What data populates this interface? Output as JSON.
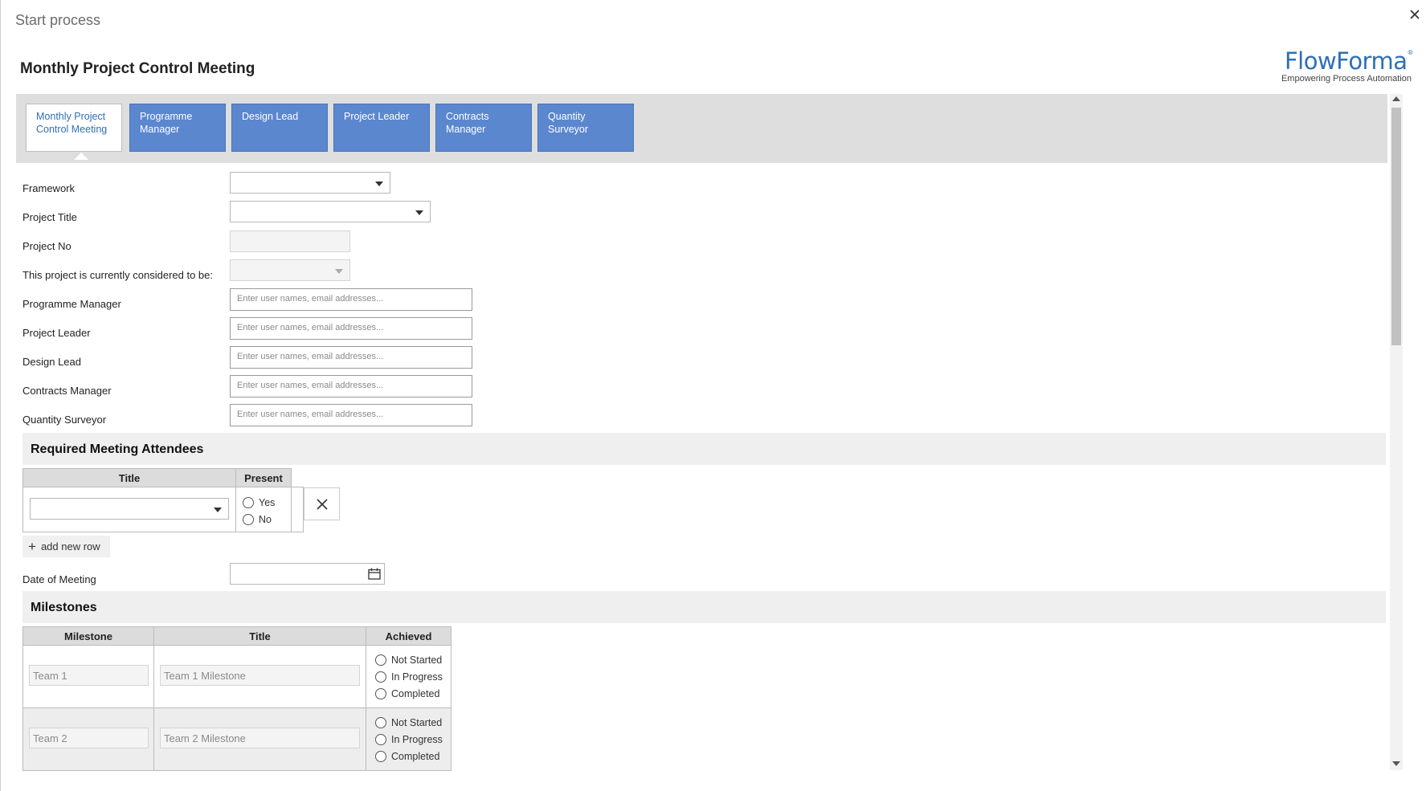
{
  "dialog": {
    "title": "Start process"
  },
  "form": {
    "title": "Monthly Project Control Meeting"
  },
  "logo": {
    "name": "FlowForma",
    "reg": "®",
    "tagline": "Empowering Process Automation",
    "color": "#2f6fb9"
  },
  "tabs": [
    {
      "label": "Monthly Project Control Meeting",
      "active": true
    },
    {
      "label": "Programme Manager",
      "active": false
    },
    {
      "label": "Design Lead",
      "active": false
    },
    {
      "label": "Project Leader",
      "active": false
    },
    {
      "label": "Contracts Manager",
      "active": false
    },
    {
      "label": "Quantity Surveyor",
      "active": false
    }
  ],
  "fields": {
    "framework": {
      "label": "Framework",
      "value": ""
    },
    "project_title": {
      "label": "Project Title",
      "value": ""
    },
    "project_no": {
      "label": "Project No",
      "value": ""
    },
    "considered": {
      "label": "This project is currently considered to be:",
      "value": ""
    },
    "programme_manager": {
      "label": "Programme Manager",
      "placeholder": "Enter user names, email addresses..."
    },
    "project_leader": {
      "label": "Project Leader",
      "placeholder": "Enter user names, email addresses..."
    },
    "design_lead": {
      "label": "Design Lead",
      "placeholder": "Enter user names, email addresses..."
    },
    "contracts_manager": {
      "label": "Contracts Manager",
      "placeholder": "Enter user names, email addresses..."
    },
    "quantity_surveyor": {
      "label": "Quantity Surveyor",
      "placeholder": "Enter user names, email addresses..."
    },
    "date_of_meeting": {
      "label": "Date of Meeting",
      "value": ""
    }
  },
  "attendees": {
    "section_title": "Required Meeting Attendees",
    "columns": [
      "Title",
      "Present"
    ],
    "present_options": [
      "Yes",
      "No"
    ],
    "add_row_label": "add new row"
  },
  "milestones": {
    "section_title": "Milestones",
    "columns": [
      "Milestone",
      "Title",
      "Achieved"
    ],
    "achieved_options": [
      "Not Started",
      "In Progress",
      "Completed"
    ],
    "rows": [
      {
        "milestone": "Team 1",
        "title": "Team 1 Milestone"
      },
      {
        "milestone": "Team 2",
        "title": "Team 2 Milestone"
      }
    ]
  },
  "colors": {
    "tab_bg": "#5b87cf",
    "tab_bar_bg": "#dedede",
    "section_bg": "#efefef"
  }
}
